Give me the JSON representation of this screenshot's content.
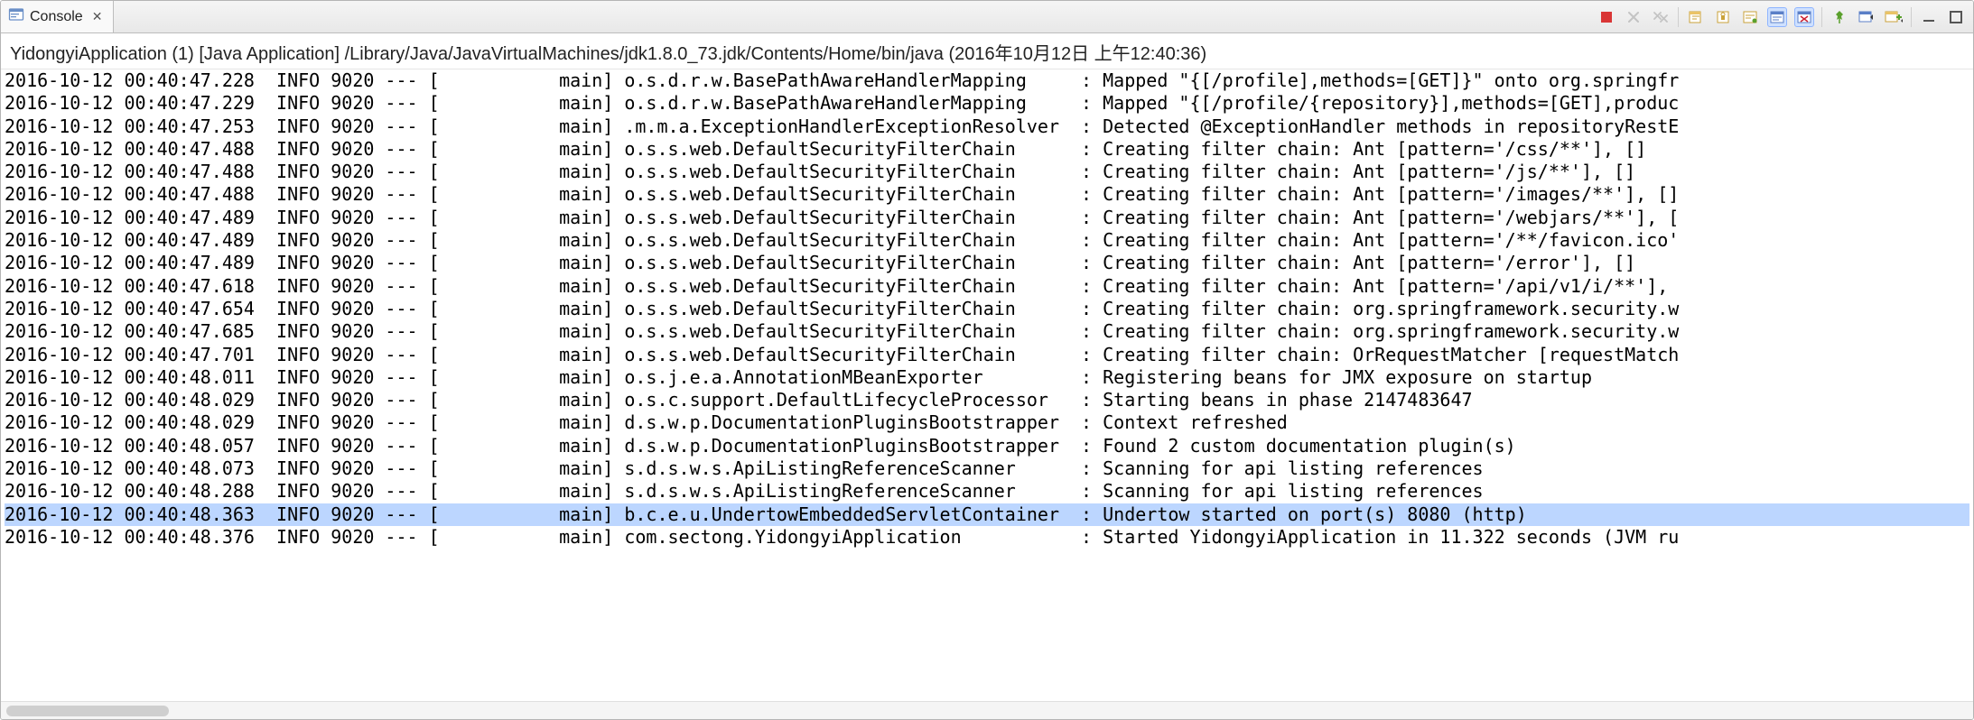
{
  "tab": {
    "title": "Console",
    "close_glyph": "✕"
  },
  "toolbar_icons": [
    "stop-icon",
    "remove-launch-icon",
    "remove-all-icon",
    "sep",
    "clear-icon",
    "scroll-lock-icon",
    "word-wrap-icon",
    "show-whitespace-icon",
    "toggle-word-wrap-icon",
    "sep",
    "pin-icon",
    "display-tab-icon",
    "new-console-icon",
    "sep",
    "minimize-icon",
    "maximize-icon"
  ],
  "process_line": "YidongyiApplication (1) [Java Application] /Library/Java/JavaVirtualMachines/jdk1.8.0_73.jdk/Contents/Home/bin/java (2016年10月12日 上午12:40:36)",
  "log": [
    {
      "ts": "2016-10-12 00:40:47.228",
      "lvl": "INFO",
      "pid": "9020",
      "dash": "---",
      "thread": "[           main]",
      "logger": "o.s.d.r.w.BasePathAwareHandlerMapping     ",
      "msg": "Mapped \"{[/profile],methods=[GET]}\" onto org.springfr"
    },
    {
      "ts": "2016-10-12 00:40:47.229",
      "lvl": "INFO",
      "pid": "9020",
      "dash": "---",
      "thread": "[           main]",
      "logger": "o.s.d.r.w.BasePathAwareHandlerMapping     ",
      "msg": "Mapped \"{[/profile/{repository}],methods=[GET],produc"
    },
    {
      "ts": "2016-10-12 00:40:47.253",
      "lvl": "INFO",
      "pid": "9020",
      "dash": "---",
      "thread": "[           main]",
      "logger": ".m.m.a.ExceptionHandlerExceptionResolver  ",
      "msg": "Detected @ExceptionHandler methods in repositoryRestE"
    },
    {
      "ts": "2016-10-12 00:40:47.488",
      "lvl": "INFO",
      "pid": "9020",
      "dash": "---",
      "thread": "[           main]",
      "logger": "o.s.s.web.DefaultSecurityFilterChain      ",
      "msg": "Creating filter chain: Ant [pattern='/css/**'], []"
    },
    {
      "ts": "2016-10-12 00:40:47.488",
      "lvl": "INFO",
      "pid": "9020",
      "dash": "---",
      "thread": "[           main]",
      "logger": "o.s.s.web.DefaultSecurityFilterChain      ",
      "msg": "Creating filter chain: Ant [pattern='/js/**'], []"
    },
    {
      "ts": "2016-10-12 00:40:47.488",
      "lvl": "INFO",
      "pid": "9020",
      "dash": "---",
      "thread": "[           main]",
      "logger": "o.s.s.web.DefaultSecurityFilterChain      ",
      "msg": "Creating filter chain: Ant [pattern='/images/**'], []"
    },
    {
      "ts": "2016-10-12 00:40:47.489",
      "lvl": "INFO",
      "pid": "9020",
      "dash": "---",
      "thread": "[           main]",
      "logger": "o.s.s.web.DefaultSecurityFilterChain      ",
      "msg": "Creating filter chain: Ant [pattern='/webjars/**'], ["
    },
    {
      "ts": "2016-10-12 00:40:47.489",
      "lvl": "INFO",
      "pid": "9020",
      "dash": "---",
      "thread": "[           main]",
      "logger": "o.s.s.web.DefaultSecurityFilterChain      ",
      "msg": "Creating filter chain: Ant [pattern='/**/favicon.ico'"
    },
    {
      "ts": "2016-10-12 00:40:47.489",
      "lvl": "INFO",
      "pid": "9020",
      "dash": "---",
      "thread": "[           main]",
      "logger": "o.s.s.web.DefaultSecurityFilterChain      ",
      "msg": "Creating filter chain: Ant [pattern='/error'], []"
    },
    {
      "ts": "2016-10-12 00:40:47.618",
      "lvl": "INFO",
      "pid": "9020",
      "dash": "---",
      "thread": "[           main]",
      "logger": "o.s.s.web.DefaultSecurityFilterChain      ",
      "msg": "Creating filter chain: Ant [pattern='/api/v1/i/**'],"
    },
    {
      "ts": "2016-10-12 00:40:47.654",
      "lvl": "INFO",
      "pid": "9020",
      "dash": "---",
      "thread": "[           main]",
      "logger": "o.s.s.web.DefaultSecurityFilterChain      ",
      "msg": "Creating filter chain: org.springframework.security.w"
    },
    {
      "ts": "2016-10-12 00:40:47.685",
      "lvl": "INFO",
      "pid": "9020",
      "dash": "---",
      "thread": "[           main]",
      "logger": "o.s.s.web.DefaultSecurityFilterChain      ",
      "msg": "Creating filter chain: org.springframework.security.w"
    },
    {
      "ts": "2016-10-12 00:40:47.701",
      "lvl": "INFO",
      "pid": "9020",
      "dash": "---",
      "thread": "[           main]",
      "logger": "o.s.s.web.DefaultSecurityFilterChain      ",
      "msg": "Creating filter chain: OrRequestMatcher [requestMatch"
    },
    {
      "ts": "2016-10-12 00:40:48.011",
      "lvl": "INFO",
      "pid": "9020",
      "dash": "---",
      "thread": "[           main]",
      "logger": "o.s.j.e.a.AnnotationMBeanExporter         ",
      "msg": "Registering beans for JMX exposure on startup"
    },
    {
      "ts": "2016-10-12 00:40:48.029",
      "lvl": "INFO",
      "pid": "9020",
      "dash": "---",
      "thread": "[           main]",
      "logger": "o.s.c.support.DefaultLifecycleProcessor   ",
      "msg": "Starting beans in phase 2147483647"
    },
    {
      "ts": "2016-10-12 00:40:48.029",
      "lvl": "INFO",
      "pid": "9020",
      "dash": "---",
      "thread": "[           main]",
      "logger": "d.s.w.p.DocumentationPluginsBootstrapper  ",
      "msg": "Context refreshed"
    },
    {
      "ts": "2016-10-12 00:40:48.057",
      "lvl": "INFO",
      "pid": "9020",
      "dash": "---",
      "thread": "[           main]",
      "logger": "d.s.w.p.DocumentationPluginsBootstrapper  ",
      "msg": "Found 2 custom documentation plugin(s)"
    },
    {
      "ts": "2016-10-12 00:40:48.073",
      "lvl": "INFO",
      "pid": "9020",
      "dash": "---",
      "thread": "[           main]",
      "logger": "s.d.s.w.s.ApiListingReferenceScanner      ",
      "msg": "Scanning for api listing references"
    },
    {
      "ts": "2016-10-12 00:40:48.288",
      "lvl": "INFO",
      "pid": "9020",
      "dash": "---",
      "thread": "[           main]",
      "logger": "s.d.s.w.s.ApiListingReferenceScanner      ",
      "msg": "Scanning for api listing references"
    },
    {
      "ts": "2016-10-12 00:40:48.363",
      "lvl": "INFO",
      "pid": "9020",
      "dash": "---",
      "thread": "[           main]",
      "logger": "b.c.e.u.UndertowEmbeddedServletContainer  ",
      "msg": "Undertow started on port(s) 8080 (http)",
      "selected": true
    },
    {
      "ts": "2016-10-12 00:40:48.376",
      "lvl": "INFO",
      "pid": "9020",
      "dash": "---",
      "thread": "[           main]",
      "logger": "com.sectong.YidongyiApplication           ",
      "msg": "Started YidongyiApplication in 11.322 seconds (JVM ru"
    }
  ]
}
